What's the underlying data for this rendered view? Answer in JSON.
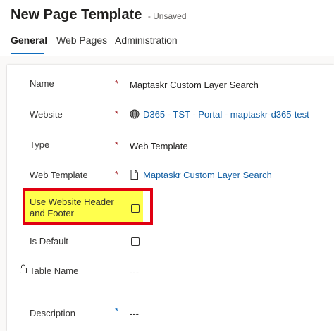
{
  "header": {
    "title": "New Page Template",
    "status": "- Unsaved"
  },
  "tabs": [
    {
      "label": "General",
      "active": true
    },
    {
      "label": "Web Pages",
      "active": false
    },
    {
      "label": "Administration",
      "active": false
    }
  ],
  "fields": {
    "name": {
      "label": "Name",
      "required": "*",
      "value": "Maptaskr Custom Layer Search"
    },
    "website": {
      "label": "Website",
      "required": "*",
      "value": "D365 - TST - Portal - maptaskr-d365-test",
      "icon": "globe-icon"
    },
    "type": {
      "label": "Type",
      "required": "*",
      "value": "Web Template"
    },
    "web_template": {
      "label": "Web Template",
      "required": "*",
      "value": "Maptaskr Custom Layer Search",
      "icon": "document-icon"
    },
    "use_header_footer": {
      "label_line1": "Use Website Header",
      "label_line2": "and Footer",
      "checked": false
    },
    "is_default": {
      "label": "Is Default",
      "checked": false
    },
    "table_name": {
      "label": "Table Name",
      "value": "---",
      "icon": "lock-icon"
    },
    "description": {
      "label": "Description",
      "required": "*",
      "value": "---"
    }
  },
  "colors": {
    "required": "#a4262c",
    "recommended": "#0f6cbd",
    "link": "#115ea3",
    "highlight": "#ffff4d",
    "highlight_border": "#e00012",
    "tab_indicator": "#0f6cbd"
  }
}
